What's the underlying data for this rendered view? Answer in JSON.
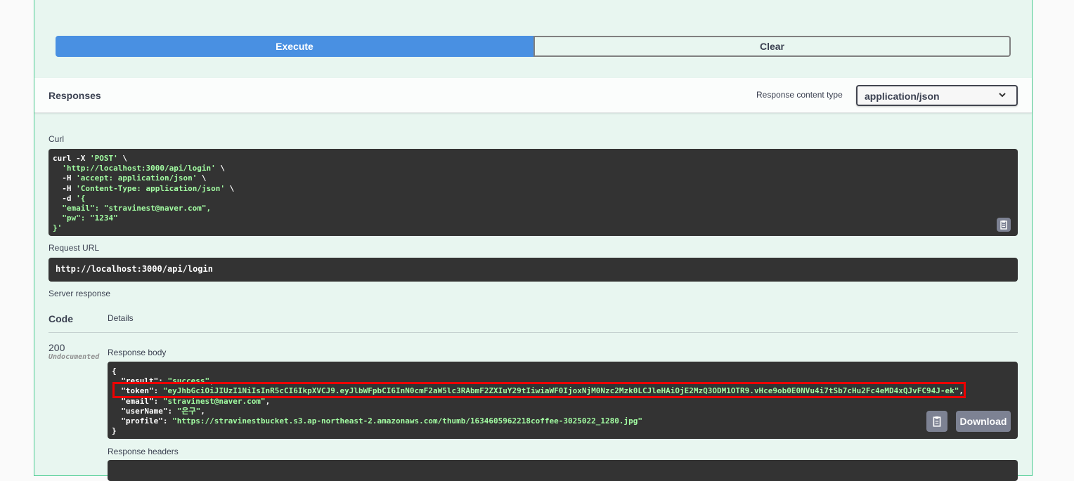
{
  "buttons": {
    "execute": "Execute",
    "clear": "Clear"
  },
  "responses": {
    "title": "Responses",
    "content_type_label": "Response content type",
    "content_type_value": "application/json"
  },
  "curl": {
    "label": "Curl",
    "lines": [
      [
        "curl -X ",
        "'POST'",
        " \\"
      ],
      [
        "  ",
        "'http://localhost:3000/api/login'",
        " \\"
      ],
      [
        "  -H ",
        "'accept: application/json'",
        " \\"
      ],
      [
        "  -H ",
        "'Content-Type: application/json'",
        " \\"
      ],
      [
        "  -d ",
        "'{",
        ""
      ],
      [
        "  ",
        "\"email\": \"stravinest@naver.com\",",
        ""
      ],
      [
        "  ",
        "\"pw\": \"1234\"",
        ""
      ],
      [
        "",
        "}'",
        ""
      ]
    ]
  },
  "request_url": {
    "label": "Request URL",
    "value": "http://localhost:3000/api/login"
  },
  "server_response": {
    "label": "Server response",
    "col_code": "Code",
    "col_details": "Details",
    "code": "200",
    "code_note": "Undocumented",
    "body_label": "Response body",
    "body_lines": [
      [
        "{",
        "",
        ""
      ],
      [
        "  \"result\": ",
        "\"success\"",
        ","
      ],
      [
        "  \"token\": ",
        "\"eyJhbGciOiJIUzI1NiIsInR5cCI6IkpXVCJ9.eyJlbWFpbCI6InN0cmF2aW5lc3RAbmF2ZXIuY29tIiwiaWF0IjoxNjM0Nzc2Mzk0LCJleHAiOjE2MzQ3ODM1OTR9.vHce9ob0E0NVu4i7tSb7cHu2Fc4eMD4xQJvFC94J-ek\"",
        ","
      ],
      [
        "  \"email\": ",
        "\"stravinest@naver.com\"",
        ","
      ],
      [
        "  \"userName\": ",
        "\"은구\"",
        ","
      ],
      [
        "  \"profile\": ",
        "\"https://stravinestbucket.s3.ap-northeast-2.amazonaws.com/thumb/1634605962218coffee-3025022_1280.jpg\"",
        ""
      ],
      [
        "}",
        "",
        ""
      ]
    ],
    "download_label": "Download",
    "headers_label": "Response headers"
  },
  "icons": {
    "copy": "clipboard-icon",
    "select": "chevron-down-icon"
  }
}
